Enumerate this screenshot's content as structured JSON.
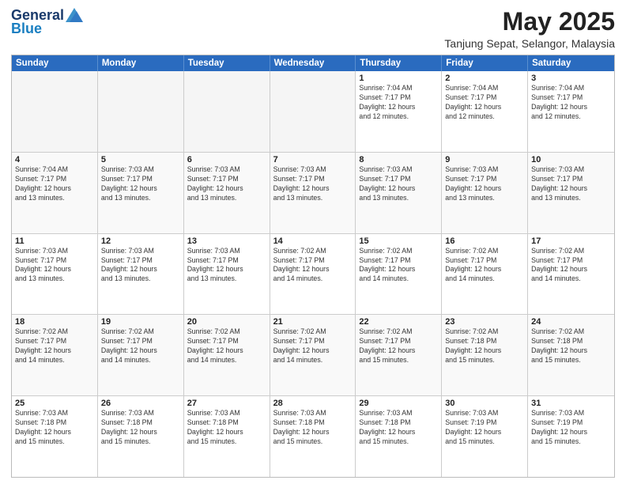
{
  "logo": {
    "general": "General",
    "blue": "Blue"
  },
  "title": "May 2025",
  "location": "Tanjung Sepat, Selangor, Malaysia",
  "days": [
    "Sunday",
    "Monday",
    "Tuesday",
    "Wednesday",
    "Thursday",
    "Friday",
    "Saturday"
  ],
  "rows": [
    [
      {
        "day": "",
        "text": ""
      },
      {
        "day": "",
        "text": ""
      },
      {
        "day": "",
        "text": ""
      },
      {
        "day": "",
        "text": ""
      },
      {
        "day": "1",
        "text": "Sunrise: 7:04 AM\nSunset: 7:17 PM\nDaylight: 12 hours\nand 12 minutes."
      },
      {
        "day": "2",
        "text": "Sunrise: 7:04 AM\nSunset: 7:17 PM\nDaylight: 12 hours\nand 12 minutes."
      },
      {
        "day": "3",
        "text": "Sunrise: 7:04 AM\nSunset: 7:17 PM\nDaylight: 12 hours\nand 12 minutes."
      }
    ],
    [
      {
        "day": "4",
        "text": "Sunrise: 7:04 AM\nSunset: 7:17 PM\nDaylight: 12 hours\nand 13 minutes."
      },
      {
        "day": "5",
        "text": "Sunrise: 7:03 AM\nSunset: 7:17 PM\nDaylight: 12 hours\nand 13 minutes."
      },
      {
        "day": "6",
        "text": "Sunrise: 7:03 AM\nSunset: 7:17 PM\nDaylight: 12 hours\nand 13 minutes."
      },
      {
        "day": "7",
        "text": "Sunrise: 7:03 AM\nSunset: 7:17 PM\nDaylight: 12 hours\nand 13 minutes."
      },
      {
        "day": "8",
        "text": "Sunrise: 7:03 AM\nSunset: 7:17 PM\nDaylight: 12 hours\nand 13 minutes."
      },
      {
        "day": "9",
        "text": "Sunrise: 7:03 AM\nSunset: 7:17 PM\nDaylight: 12 hours\nand 13 minutes."
      },
      {
        "day": "10",
        "text": "Sunrise: 7:03 AM\nSunset: 7:17 PM\nDaylight: 12 hours\nand 13 minutes."
      }
    ],
    [
      {
        "day": "11",
        "text": "Sunrise: 7:03 AM\nSunset: 7:17 PM\nDaylight: 12 hours\nand 13 minutes."
      },
      {
        "day": "12",
        "text": "Sunrise: 7:03 AM\nSunset: 7:17 PM\nDaylight: 12 hours\nand 13 minutes."
      },
      {
        "day": "13",
        "text": "Sunrise: 7:03 AM\nSunset: 7:17 PM\nDaylight: 12 hours\nand 13 minutes."
      },
      {
        "day": "14",
        "text": "Sunrise: 7:02 AM\nSunset: 7:17 PM\nDaylight: 12 hours\nand 14 minutes."
      },
      {
        "day": "15",
        "text": "Sunrise: 7:02 AM\nSunset: 7:17 PM\nDaylight: 12 hours\nand 14 minutes."
      },
      {
        "day": "16",
        "text": "Sunrise: 7:02 AM\nSunset: 7:17 PM\nDaylight: 12 hours\nand 14 minutes."
      },
      {
        "day": "17",
        "text": "Sunrise: 7:02 AM\nSunset: 7:17 PM\nDaylight: 12 hours\nand 14 minutes."
      }
    ],
    [
      {
        "day": "18",
        "text": "Sunrise: 7:02 AM\nSunset: 7:17 PM\nDaylight: 12 hours\nand 14 minutes."
      },
      {
        "day": "19",
        "text": "Sunrise: 7:02 AM\nSunset: 7:17 PM\nDaylight: 12 hours\nand 14 minutes."
      },
      {
        "day": "20",
        "text": "Sunrise: 7:02 AM\nSunset: 7:17 PM\nDaylight: 12 hours\nand 14 minutes."
      },
      {
        "day": "21",
        "text": "Sunrise: 7:02 AM\nSunset: 7:17 PM\nDaylight: 12 hours\nand 14 minutes."
      },
      {
        "day": "22",
        "text": "Sunrise: 7:02 AM\nSunset: 7:17 PM\nDaylight: 12 hours\nand 15 minutes."
      },
      {
        "day": "23",
        "text": "Sunrise: 7:02 AM\nSunset: 7:18 PM\nDaylight: 12 hours\nand 15 minutes."
      },
      {
        "day": "24",
        "text": "Sunrise: 7:02 AM\nSunset: 7:18 PM\nDaylight: 12 hours\nand 15 minutes."
      }
    ],
    [
      {
        "day": "25",
        "text": "Sunrise: 7:03 AM\nSunset: 7:18 PM\nDaylight: 12 hours\nand 15 minutes."
      },
      {
        "day": "26",
        "text": "Sunrise: 7:03 AM\nSunset: 7:18 PM\nDaylight: 12 hours\nand 15 minutes."
      },
      {
        "day": "27",
        "text": "Sunrise: 7:03 AM\nSunset: 7:18 PM\nDaylight: 12 hours\nand 15 minutes."
      },
      {
        "day": "28",
        "text": "Sunrise: 7:03 AM\nSunset: 7:18 PM\nDaylight: 12 hours\nand 15 minutes."
      },
      {
        "day": "29",
        "text": "Sunrise: 7:03 AM\nSunset: 7:18 PM\nDaylight: 12 hours\nand 15 minutes."
      },
      {
        "day": "30",
        "text": "Sunrise: 7:03 AM\nSunset: 7:19 PM\nDaylight: 12 hours\nand 15 minutes."
      },
      {
        "day": "31",
        "text": "Sunrise: 7:03 AM\nSunset: 7:19 PM\nDaylight: 12 hours\nand 15 minutes."
      }
    ]
  ]
}
